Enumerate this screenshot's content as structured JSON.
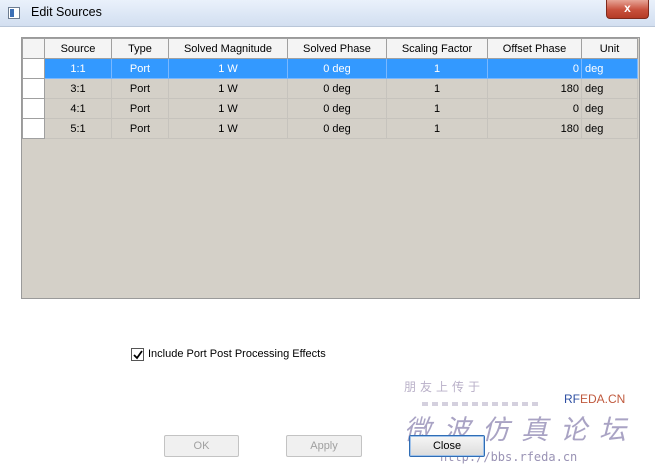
{
  "window": {
    "title": "Edit Sources",
    "close_glyph": "x"
  },
  "table": {
    "columns": [
      "Source",
      "Type",
      "Solved Magnitude",
      "Solved Phase",
      "Scaling Factor",
      "Offset Phase",
      "Unit"
    ],
    "rows": [
      {
        "source": "1:1",
        "type": "Port",
        "magnitude": "1 W",
        "phase": "0 deg",
        "scaling": "1",
        "offset": "0",
        "unit": "deg",
        "selected": true
      },
      {
        "source": "3:1",
        "type": "Port",
        "magnitude": "1 W",
        "phase": "0 deg",
        "scaling": "1",
        "offset": "180",
        "unit": "deg",
        "selected": false
      },
      {
        "source": "4:1",
        "type": "Port",
        "magnitude": "1 W",
        "phase": "0 deg",
        "scaling": "1",
        "offset": "0",
        "unit": "deg",
        "selected": false
      },
      {
        "source": "5:1",
        "type": "Port",
        "magnitude": "1 W",
        "phase": "0 deg",
        "scaling": "1",
        "offset": "180",
        "unit": "deg",
        "selected": false
      }
    ]
  },
  "options": {
    "include_port_post_processing": {
      "label": "Include Port Post Processing Effects",
      "checked": true
    }
  },
  "buttons": {
    "ok": "OK",
    "apply": "Apply",
    "close": "Close"
  },
  "watermark": {
    "top_text": "朋友上传于",
    "brand_prefix": "RF",
    "brand_suffix": "EDA.CN",
    "main_text": "微波仿真论坛",
    "url": "http://bbs.rfeda.cn"
  },
  "colors": {
    "selection": "#3399ff",
    "grid_background": "#d4d0c8",
    "close_button": "#c8503c"
  }
}
